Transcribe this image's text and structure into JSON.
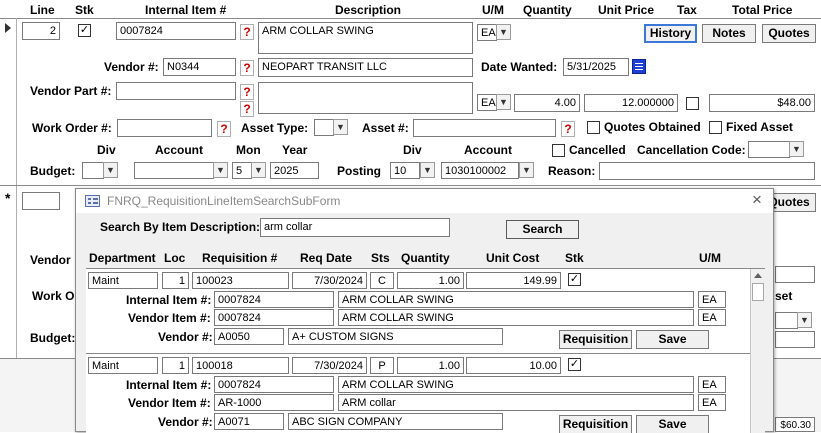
{
  "header": {
    "line": "Line",
    "stk": "Stk",
    "internal_item": "Internal Item #",
    "description": "Description",
    "um": "U/M",
    "quantity": "Quantity",
    "unit_price": "Unit Price",
    "tax": "Tax",
    "total_price": "Total Price"
  },
  "record": {
    "line": "2",
    "stk_checked": "✓",
    "internal_item": "0007824",
    "description": "ARM COLLAR SWING",
    "um": "EA",
    "vendor_label": "Vendor #:",
    "vendor": "N0344",
    "vendor_name": "NEOPART TRANSIT LLC",
    "date_wanted_label": "Date Wanted:",
    "date_wanted": "5/31/2025",
    "vendor_part_label": "Vendor Part #:",
    "um2": "EA",
    "quantity": "4.00",
    "unit_price": "12.000000",
    "total_price": "$48.00",
    "work_order_label": "Work Order #:",
    "asset_type_label": "Asset Type:",
    "asset_label": "Asset #:",
    "quotes_obtained": "Quotes Obtained",
    "fixed_asset": "Fixed Asset",
    "div_label": "Div",
    "account_label": "Account",
    "mon_label": "Mon",
    "year_label": "Year",
    "budget_label": "Budget:",
    "mon": "5",
    "year": "2025",
    "posting_label": "Posting",
    "posting_div_label": "Div",
    "posting_account_label": "Account",
    "posting_div": "10",
    "posting_account": "1030100002",
    "cancelled": "Cancelled",
    "cancellation_code_label": "Cancellation Code:",
    "reason_label": "Reason:"
  },
  "buttons": {
    "history": "History",
    "notes": "Notes",
    "quotes": "Quotes"
  },
  "new_record": {
    "new_row_marker": "*",
    "quotes": "Quotes",
    "vendor_partial": "Vendor",
    "work_order_partial": "Work O",
    "budget_partial": "Budget:",
    "asset_partial": "set",
    "total_partial": "$60.30"
  },
  "subform": {
    "title": "FNRQ_RequisitionLineItemSearchSubForm",
    "search_label": "Search By Item Description:",
    "search_value": "arm collar",
    "search_button": "Search",
    "columns": {
      "department": "Department",
      "loc": "Loc",
      "requisition": "Requisition #",
      "req_date": "Req Date",
      "sts": "Sts",
      "quantity": "Quantity",
      "unit_cost": "Unit Cost",
      "stk": "Stk",
      "um": "U/M"
    },
    "internal_item_label": "Internal Item #:",
    "vendor_item_label": "Vendor Item #:",
    "vendor_label": "Vendor #:",
    "requisition_button": "Requisition",
    "save_button": "Save",
    "rows": [
      {
        "department": "Maint",
        "loc": "1",
        "requisition": "100023",
        "req_date": "7/30/2024",
        "sts": "C",
        "quantity": "1.00",
        "unit_cost": "149.99",
        "stk": "✓",
        "internal_item": "0007824",
        "internal_desc": "ARM COLLAR SWING",
        "internal_um": "EA",
        "vendor_item": "0007824",
        "vendor_desc": "ARM COLLAR SWING",
        "vendor_um": "EA",
        "vendor": "A0050",
        "vendor_name": "A+ CUSTOM SIGNS"
      },
      {
        "department": "Maint",
        "loc": "1",
        "requisition": "100018",
        "req_date": "7/30/2024",
        "sts": "P",
        "quantity": "1.00",
        "unit_cost": "10.00",
        "stk": "✓",
        "internal_item": "0007824",
        "internal_desc": "ARM COLLAR SWING",
        "internal_um": "EA",
        "vendor_item": "AR-1000",
        "vendor_desc": "ARM collar",
        "vendor_um": "EA",
        "vendor": "A0071",
        "vendor_name": "ABC SIGN COMPANY"
      }
    ]
  }
}
